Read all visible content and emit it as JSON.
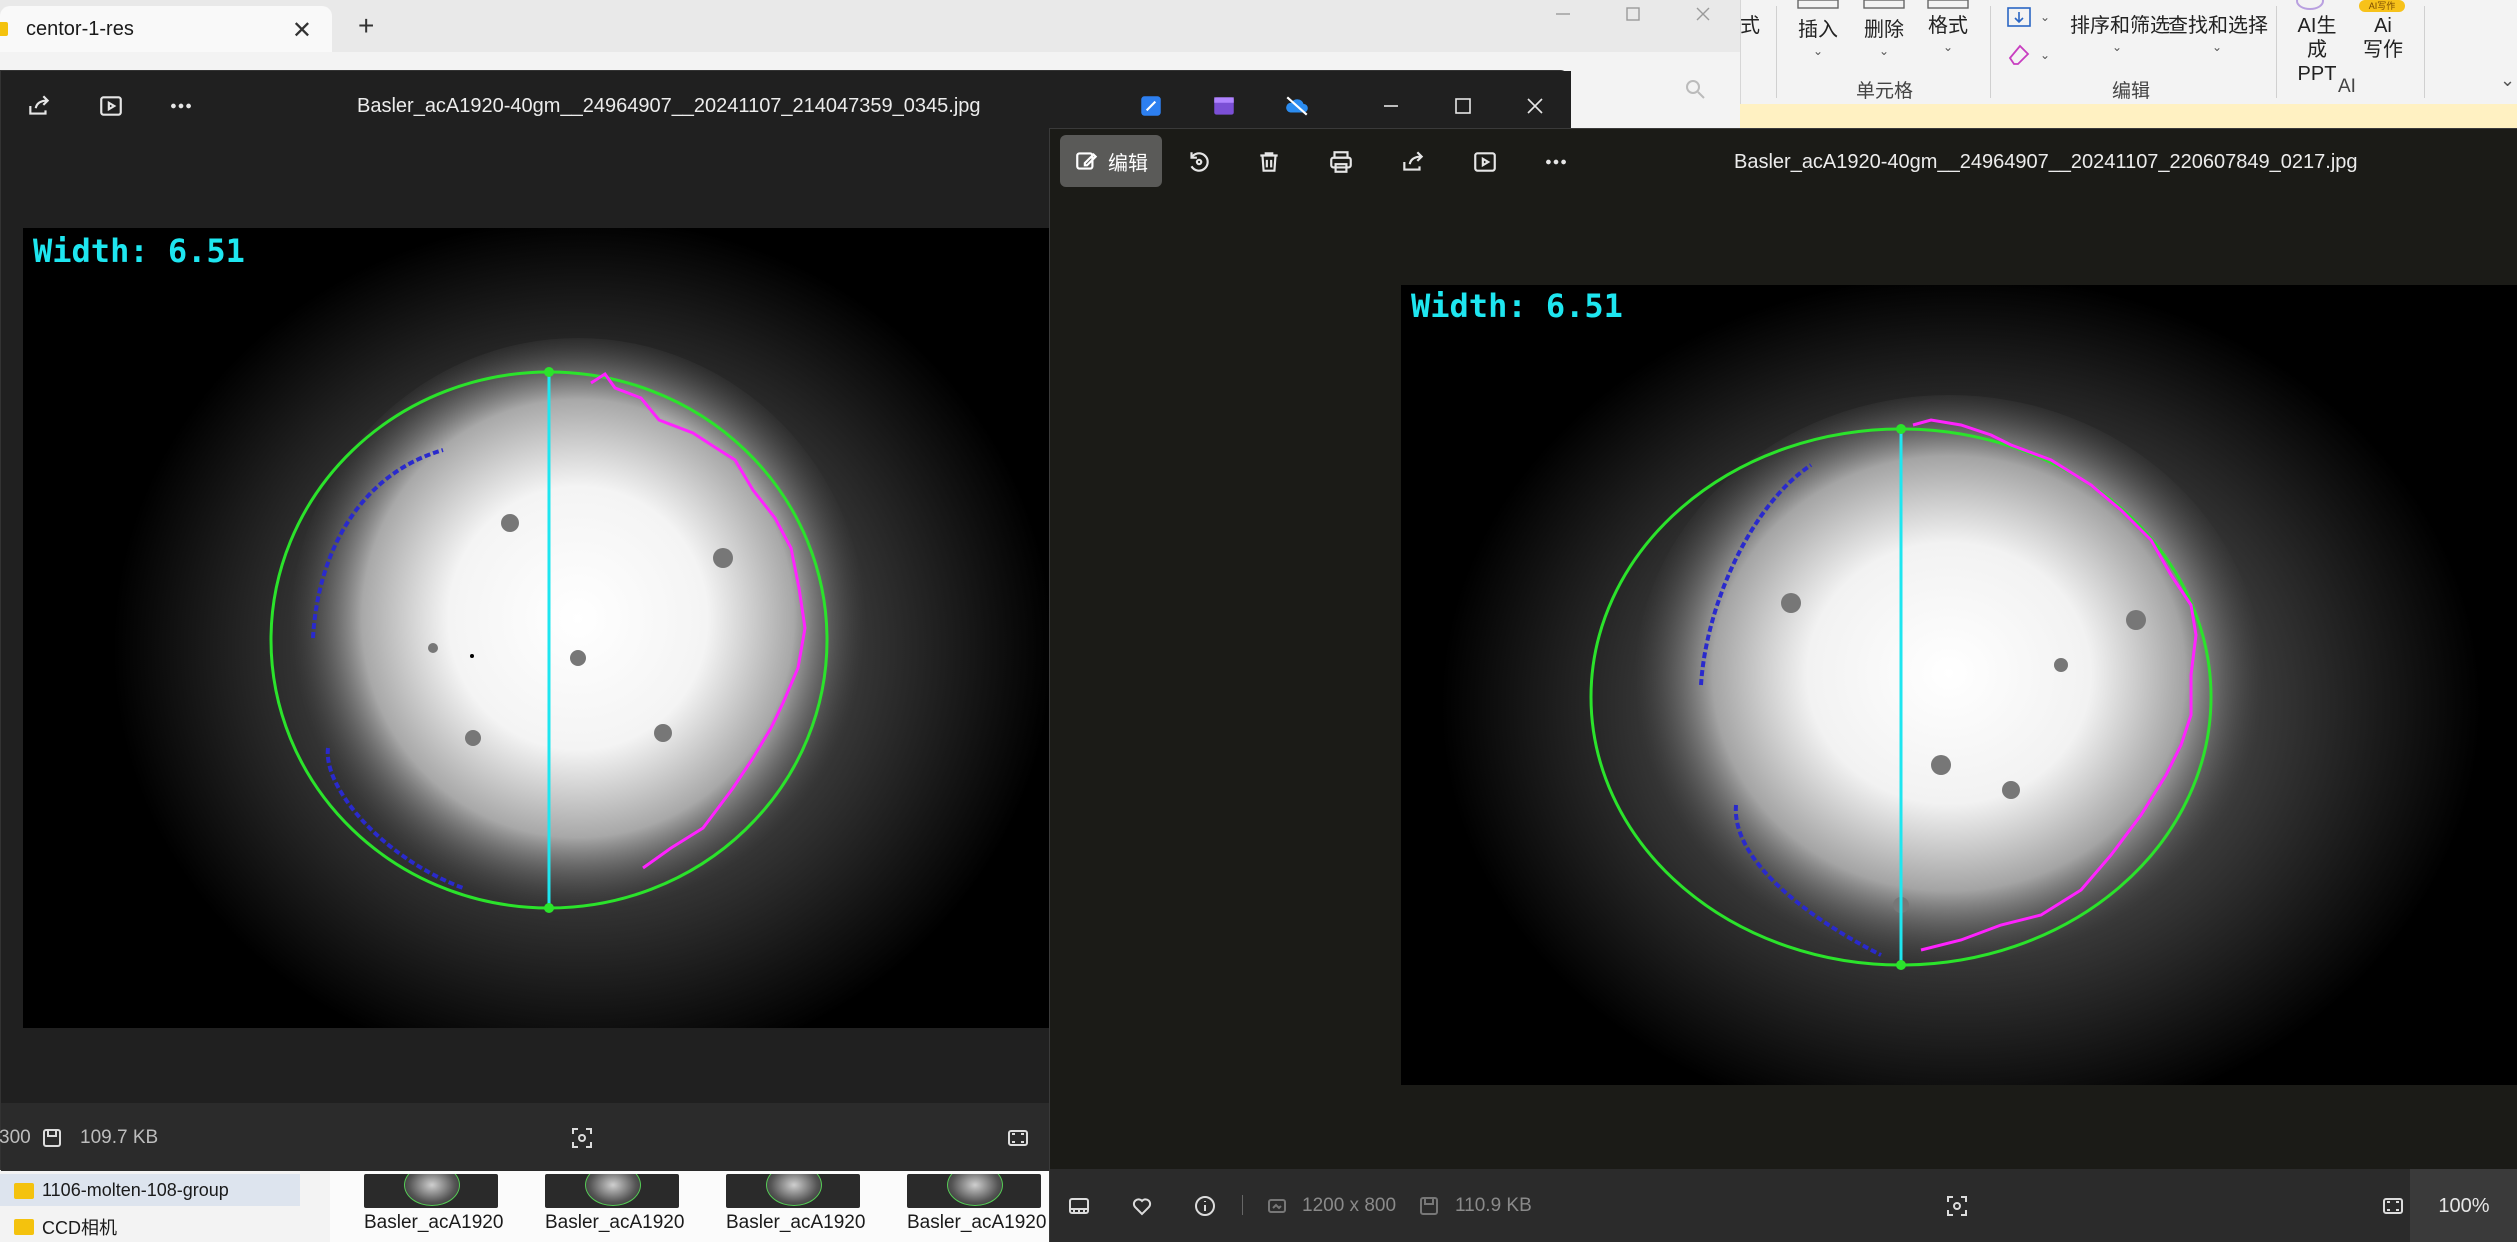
{
  "explorer": {
    "tab_title": "centor-1-res",
    "tab_close": "✕",
    "new_tab": "+",
    "nav_items": [
      "1106-molten-108-group",
      "CCD相机"
    ],
    "thumb_labels": [
      "Basler_acA1920",
      "Basler_acA1920",
      "Basler_acA1920",
      "Basler_acA1920"
    ]
  },
  "excel": {
    "partial_label": "式",
    "buttons": {
      "insert": "插入",
      "delete": "删除",
      "format": "格式",
      "sort_filter": "排序和筛选",
      "find_select": "查找和选择",
      "ai_ppt_line1": "AI生",
      "ai_ppt_line2": "成PPT",
      "ai_write_line1": "Ai",
      "ai_write_line2": "写作",
      "ai_badge": "AI写作"
    },
    "groups": {
      "cells": "单元格",
      "edit": "编辑",
      "ai": "AI"
    }
  },
  "viewer1": {
    "file_title": "Basler_acA1920-40gm__24964907__20241107_214047359_0345.jpg",
    "measurement": "Width: 6.51",
    "status": {
      "dims_partial": "300",
      "size": "109.7 KB"
    }
  },
  "viewer2": {
    "edit_label": "编辑",
    "file_title": "Basler_acA1920-40gm__24964907__20241107_220607849_0217.jpg",
    "measurement": "Width: 6.51",
    "status": {
      "dims": "1200 x 800",
      "size": "110.9 KB",
      "zoom": "100%"
    }
  },
  "colors": {
    "fit_circle": "#2be32b",
    "contour": "#ff22ff",
    "edge_points": "#2a2acc",
    "width_line": "#1ee6f0",
    "viewer_bg": "#202020",
    "edit_button_bg": "#5a5a58"
  },
  "icons": [
    "share-icon",
    "slideshow-icon",
    "more-icon",
    "edit-photo-icon",
    "rotate-icon",
    "delete-icon",
    "print-icon",
    "filmstrip-icon",
    "favorite-icon",
    "info-icon",
    "crop-face-icon",
    "fit-screen-icon",
    "search-icon",
    "minimize-icon",
    "maximize-icon",
    "close-icon"
  ]
}
